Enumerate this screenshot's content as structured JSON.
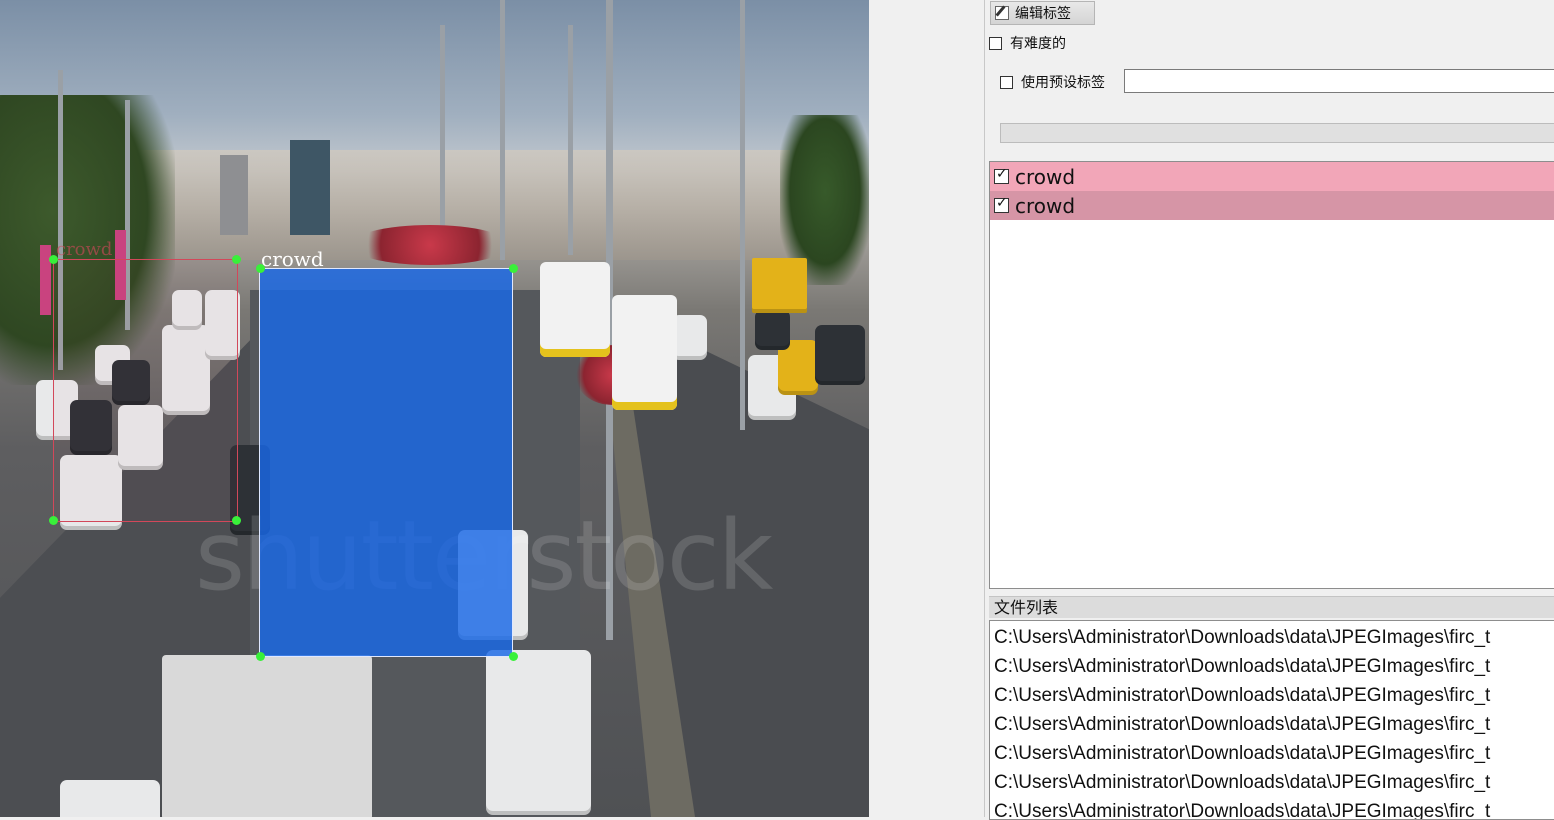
{
  "toolbar": {
    "edit_label_button": "编辑标签"
  },
  "options": {
    "difficult_label": "有难度的",
    "use_preset_label": "使用预设标签",
    "preset_value": ""
  },
  "labels": [
    {
      "name": "crowd",
      "checked": true,
      "color": "#f2a6b8"
    },
    {
      "name": "crowd",
      "checked": true,
      "color": "#d695a6"
    }
  ],
  "canvas": {
    "annotations": [
      {
        "label": "crowd",
        "color": "#d2485a"
      },
      {
        "label": "crowd",
        "color": "#1868e6",
        "selected": true
      }
    ],
    "watermark": "shutterstock"
  },
  "file_list": {
    "title": "文件列表",
    "files": [
      "C:\\Users\\Administrator\\Downloads\\data\\JPEGImages\\firc_t",
      "C:\\Users\\Administrator\\Downloads\\data\\JPEGImages\\firc_t",
      "C:\\Users\\Administrator\\Downloads\\data\\JPEGImages\\firc_t",
      "C:\\Users\\Administrator\\Downloads\\data\\JPEGImages\\firc_t",
      "C:\\Users\\Administrator\\Downloads\\data\\JPEGImages\\firc_t",
      "C:\\Users\\Administrator\\Downloads\\data\\JPEGImages\\firc_t",
      "C:\\Users\\Administrator\\Downloads\\data\\JPEGImages\\firc_t"
    ]
  }
}
